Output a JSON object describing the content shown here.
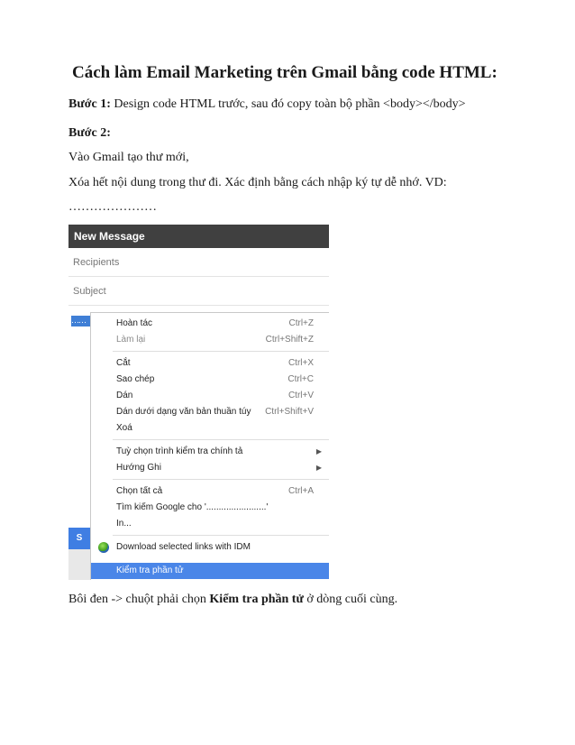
{
  "document": {
    "title": "Cách làm Email Marketing trên Gmail bằng code HTML:",
    "step1_label": "Bước 1:",
    "step1_text": " Design code HTML trước, sau đó copy toàn bộ phần <body></body>",
    "step2_label": "Bước 2:",
    "line1": "Vào Gmail tạo thư mới,",
    "line2": "Xóa hết nội dung trong thư đi. Xác định bằng cách nhập ký tự dễ nhớ. VD:",
    "dots": "…………………",
    "footer_prefix": "Bôi đen -> chuột phải chọn ",
    "footer_bold": "Kiểm tra phần tử",
    "footer_suffix": " ở dòng cuối cùng."
  },
  "compose": {
    "header": "New Message",
    "recipients_placeholder": "Recipients",
    "subject_placeholder": "Subject",
    "selected_text": "……",
    "send_label": "S"
  },
  "context_menu": {
    "undo": {
      "label": "Hoàn tác",
      "shortcut": "Ctrl+Z"
    },
    "redo": {
      "label": "Làm lại",
      "shortcut": "Ctrl+Shift+Z"
    },
    "cut": {
      "label": "Cắt",
      "shortcut": "Ctrl+X"
    },
    "copy": {
      "label": "Sao chép",
      "shortcut": "Ctrl+C"
    },
    "paste": {
      "label": "Dán",
      "shortcut": "Ctrl+V"
    },
    "paste_plain": {
      "label": "Dán dưới dạng văn bản thuần túy",
      "shortcut": "Ctrl+Shift+V"
    },
    "delete": {
      "label": "Xoá"
    },
    "spellcheck": {
      "label": "Tuỳ chọn trình kiểm tra chính tả"
    },
    "direction": {
      "label": "Hướng Ghi"
    },
    "select_all": {
      "label": "Chọn tất cả",
      "shortcut": "Ctrl+A"
    },
    "search_google": {
      "label": "Tìm kiếm Google cho '........................'"
    },
    "print": {
      "label": "In..."
    },
    "idm": {
      "label": "Download selected links with IDM",
      "icon": "idm-icon"
    },
    "inspect": {
      "label": "Kiểm tra phần tử"
    },
    "submenu_arrow": "▶",
    "highlight_color": "#4a86e8"
  }
}
